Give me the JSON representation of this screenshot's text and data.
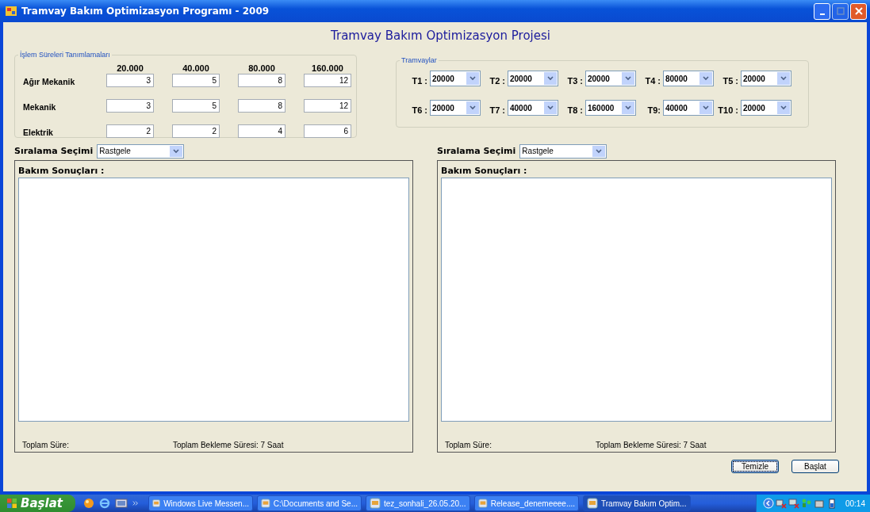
{
  "window": {
    "title": "Tramvay Bakım Optimizasyon Programı - 2009"
  },
  "heading": "Tramvay Bakım Optimizasyon Projesi",
  "durations": {
    "title": "İşlem Süreleri  Tanımlamaları",
    "columns": [
      "20.000",
      "40.000",
      "80.000",
      "160.000"
    ],
    "rows": [
      {
        "label": "Ağır Mekanik",
        "values": [
          "3",
          "5",
          "8",
          "12"
        ]
      },
      {
        "label": "Mekanik",
        "values": [
          "3",
          "5",
          "8",
          "12"
        ]
      },
      {
        "label": "Elektrik",
        "values": [
          "2",
          "2",
          "4",
          "6"
        ]
      }
    ]
  },
  "trams": {
    "title": "Tramvaylar",
    "items": [
      {
        "label": "T1 :",
        "value": "20000"
      },
      {
        "label": "T2 :",
        "value": "20000"
      },
      {
        "label": "T3 :",
        "value": "20000"
      },
      {
        "label": "T4 :",
        "value": "80000"
      },
      {
        "label": "T5 :",
        "value": "20000"
      },
      {
        "label": "T6 :",
        "value": "20000"
      },
      {
        "label": "T7 :",
        "value": "40000"
      },
      {
        "label": "T8 :",
        "value": "160000"
      },
      {
        "label": "T9:",
        "value": "40000"
      },
      {
        "label": "T10 :",
        "value": "20000"
      }
    ]
  },
  "panels": [
    {
      "sort_label": "Sıralama Seçimi",
      "sort_value": "Rastgele",
      "results_label": "Bakım Sonuçları :",
      "total_label": "Toplam Süre:",
      "wait_label": "Toplam Bekleme Süresi: 7 Saat"
    },
    {
      "sort_label": "Sıralama Seçimi",
      "sort_value": "Rastgele",
      "results_label": "Bakım Sonuçları :",
      "total_label": "Toplam Süre:",
      "wait_label": "Toplam Bekleme Süresi: 7 Saat"
    }
  ],
  "buttons": [
    {
      "label": "Temizle",
      "focused": true
    },
    {
      "label": "Başlat",
      "focused": false
    }
  ],
  "taskbar": {
    "start": "Başlat",
    "tasks": [
      {
        "label": "Windows Live Messen...",
        "selected": false
      },
      {
        "label": "C:\\Documents and Se...",
        "selected": false
      },
      {
        "label": "tez_sonhali_26.05.20...",
        "selected": false
      },
      {
        "label": "Release_denemeeee....",
        "selected": false
      },
      {
        "label": "Tramvay Bakım Optim...",
        "selected": true
      }
    ],
    "clock": "00:14"
  }
}
